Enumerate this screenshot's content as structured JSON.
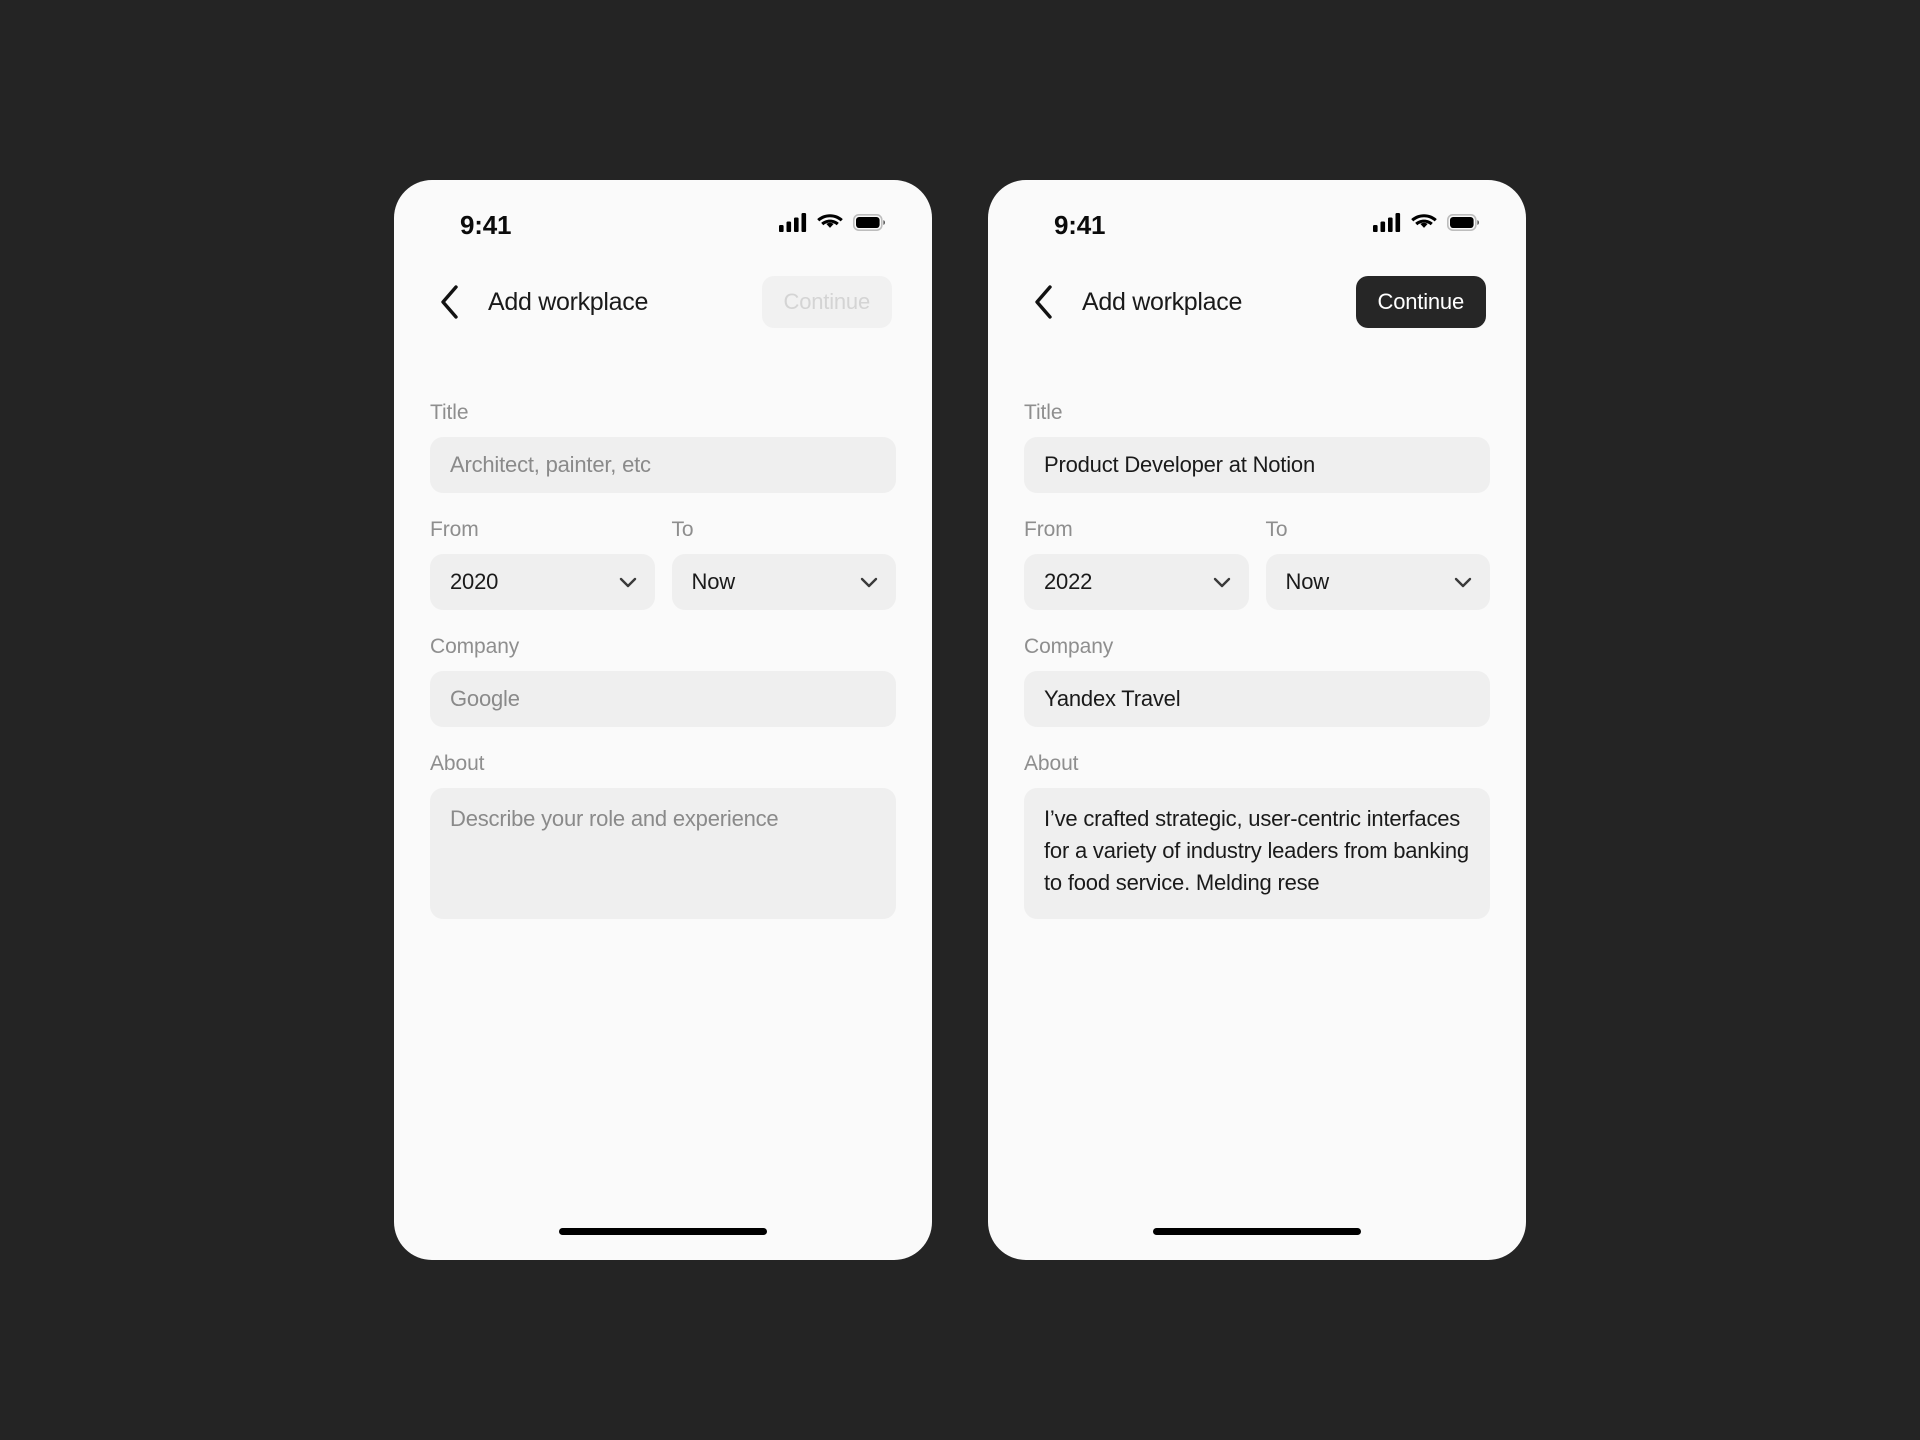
{
  "canvas": {
    "background_color": "#242424",
    "phone_background_color": "#fafafa"
  },
  "theme": {
    "accent_dark": "#262626",
    "field_fill": "#efefef",
    "label_gray": "#8e8e8e",
    "placeholder_gray": "#8a8a8a",
    "disabled_fill": "#f1f1f1",
    "disabled_text": "#d4d4d4"
  },
  "screens": [
    {
      "id": "empty-state",
      "status_bar": {
        "time": "9:41",
        "icons": [
          "cellular-signal-icon",
          "wifi-icon",
          "battery-icon"
        ]
      },
      "nav": {
        "back_icon": "chevron-left-icon",
        "title": "Add workplace",
        "continue_label": "Continue",
        "continue_enabled": false
      },
      "form": {
        "title": {
          "label": "Title",
          "value": "",
          "placeholder": "Architect, painter, etc",
          "filled": false
        },
        "from": {
          "label": "From",
          "value": "2020",
          "chevron_icon": "chevron-down-icon"
        },
        "to": {
          "label": "To",
          "value": "Now",
          "chevron_icon": "chevron-down-icon"
        },
        "company": {
          "label": "Company",
          "value": "",
          "placeholder": "Google",
          "filled": false
        },
        "about": {
          "label": "About",
          "value": "",
          "placeholder": "Describe your role and experience",
          "filled": false
        }
      },
      "home_indicator": true
    },
    {
      "id": "filled-state",
      "status_bar": {
        "time": "9:41",
        "icons": [
          "cellular-signal-icon",
          "wifi-icon",
          "battery-icon"
        ]
      },
      "nav": {
        "back_icon": "chevron-left-icon",
        "title": "Add workplace",
        "continue_label": "Continue",
        "continue_enabled": true
      },
      "form": {
        "title": {
          "label": "Title",
          "value": "Product Developer at Notion",
          "placeholder": "Architect, painter, etc",
          "filled": true
        },
        "from": {
          "label": "From",
          "value": "2022",
          "chevron_icon": "chevron-down-icon"
        },
        "to": {
          "label": "To",
          "value": "Now",
          "chevron_icon": "chevron-down-icon"
        },
        "company": {
          "label": "Company",
          "value": "Yandex Travel",
          "placeholder": "Google",
          "filled": true
        },
        "about": {
          "label": "About",
          "value": "I’ve crafted strategic, user-centric interfaces for a variety of industry leaders from banking to food service. Melding rese",
          "placeholder": "Describe your role and experience",
          "filled": true
        }
      },
      "home_indicator": true
    }
  ]
}
